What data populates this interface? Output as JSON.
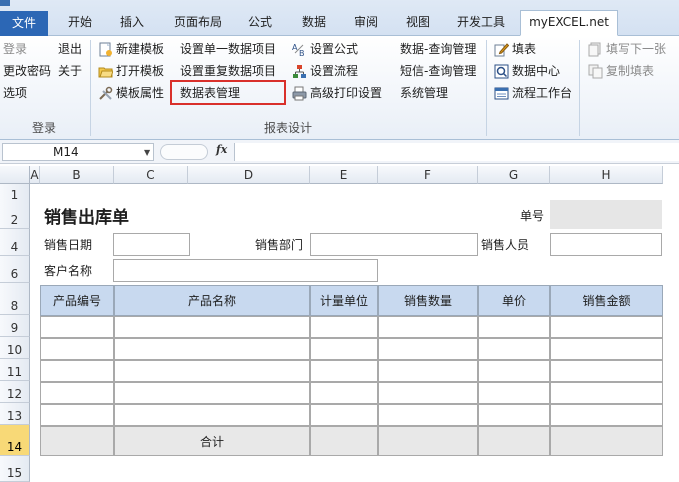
{
  "tabs": {
    "file": "文件",
    "home": "开始",
    "insert": "插入",
    "page_layout": "页面布局",
    "formulas": "公式",
    "data": "数据",
    "review": "审阅",
    "view": "视图",
    "developer": "开发工具",
    "myexcel": "myEXCEL.net"
  },
  "ribbon": {
    "login_group": {
      "login": "登录",
      "logout": "退出",
      "change_password": "更改密码",
      "about": "关于",
      "options": "选项",
      "label": "登录"
    },
    "report_group": {
      "new_template": "新建模板",
      "open_template": "打开模板",
      "template_props": "模板属性",
      "set_single_item": "设置单一数据项目",
      "set_repeat_item": "设置重复数据项目",
      "table_management": "数据表管理",
      "set_formula": "设置公式",
      "set_workflow": "设置流程",
      "advanced_print": "高级打印设置",
      "data_query": "数据-查询管理",
      "sms_query": "短信-查询管理",
      "system_management": "系统管理",
      "label": "报表设计"
    },
    "fill_group": {
      "fill_form": "填表",
      "data_center": "数据中心",
      "workflow_desk": "流程工作台",
      "fill_next": "填写下一张",
      "copy_fill": "复制填表"
    }
  },
  "formula_bar": {
    "name_box": "M14",
    "fx": "fx",
    "formula": ""
  },
  "columns": [
    "A",
    "B",
    "C",
    "D",
    "E",
    "F",
    "G",
    "H"
  ],
  "rows": [
    "1",
    "2",
    "4",
    "6",
    "8",
    "9",
    "10",
    "11",
    "12",
    "13",
    "14",
    "15"
  ],
  "selected_row": "14",
  "sheet": {
    "title": "销售出库单",
    "order_no_label": "单号",
    "sale_date_label": "销售日期",
    "sale_dept_label": "销售部门",
    "salesperson_label": "销售人员",
    "customer_label": "客户名称",
    "table_headers": [
      "产品编号",
      "产品名称",
      "计量单位",
      "销售数量",
      "单价",
      "销售金额"
    ],
    "total_label": "合计"
  }
}
